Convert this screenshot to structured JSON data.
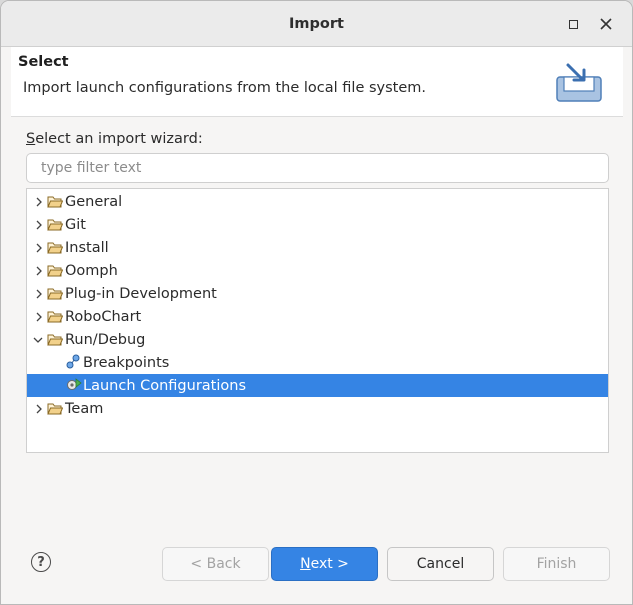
{
  "window": {
    "title": "Import"
  },
  "header": {
    "title": "Select",
    "description": "Import launch configurations from the local file system."
  },
  "wizard_label": {
    "mnemonic": "S",
    "rest": "elect an import wizard:"
  },
  "filter": {
    "placeholder": "type filter text",
    "value": ""
  },
  "tree": {
    "items": [
      {
        "label": "General",
        "icon": "folder-icon",
        "expanded": false
      },
      {
        "label": "Git",
        "icon": "folder-icon",
        "expanded": false
      },
      {
        "label": "Install",
        "icon": "folder-icon",
        "expanded": false
      },
      {
        "label": "Oomph",
        "icon": "folder-icon",
        "expanded": false
      },
      {
        "label": "Plug-in Development",
        "icon": "folder-icon",
        "expanded": false
      },
      {
        "label": "RoboChart",
        "icon": "folder-icon",
        "expanded": false
      },
      {
        "label": "Run/Debug",
        "icon": "folder-open-icon",
        "expanded": true
      },
      {
        "label": "Breakpoints",
        "icon": "breakpoints-icon"
      },
      {
        "label": "Launch Configurations",
        "icon": "launch-config-icon",
        "selected": true
      },
      {
        "label": "Team",
        "icon": "folder-icon",
        "expanded": false
      }
    ]
  },
  "buttons": {
    "back": "< Back",
    "next_mnemonic": "N",
    "next_rest": "ext >",
    "cancel": "Cancel",
    "finish": "Finish"
  },
  "colors": {
    "selection": "#3584e4",
    "primary": "#3584e4"
  }
}
